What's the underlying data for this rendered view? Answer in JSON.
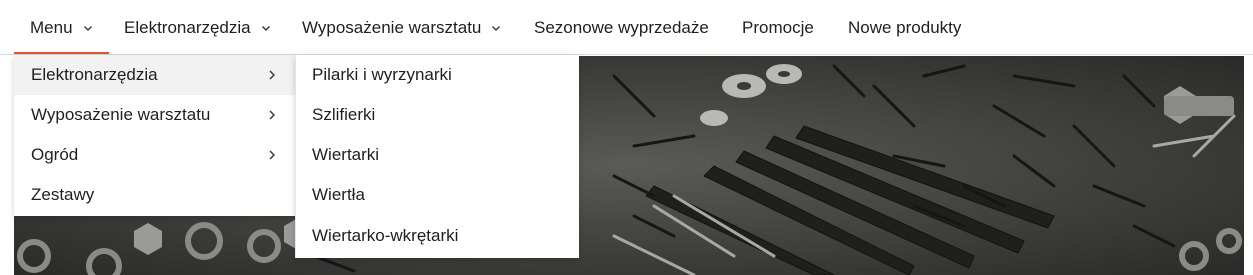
{
  "nav": {
    "items": [
      {
        "label": "Menu",
        "has_chevron": true
      },
      {
        "label": "Elektronarzędzia",
        "has_chevron": true
      },
      {
        "label": "Wyposażenie warsztatu",
        "has_chevron": true
      },
      {
        "label": "Sezonowe wyprzedaże",
        "has_chevron": false
      },
      {
        "label": "Promocje",
        "has_chevron": false
      },
      {
        "label": "Nowe produkty",
        "has_chevron": false
      }
    ],
    "active_index": 0,
    "accent_color": "#e2552b"
  },
  "dropdown": {
    "items": [
      {
        "label": "Elektronarzędzia",
        "has_arrow": true,
        "highlighted": true
      },
      {
        "label": "Wyposażenie warsztatu",
        "has_arrow": true,
        "highlighted": false
      },
      {
        "label": "Ogród",
        "has_arrow": true,
        "highlighted": false
      },
      {
        "label": "Zestawy",
        "has_arrow": false,
        "highlighted": false
      }
    ]
  },
  "submenu": {
    "items": [
      {
        "label": "Pilarki i wyrzynarki"
      },
      {
        "label": "Szlifierki"
      },
      {
        "label": "Wiertarki"
      },
      {
        "label": "Wiertła"
      },
      {
        "label": "Wiertarko-wkrętarki"
      }
    ]
  },
  "hero": {
    "icon": "hardware-photo"
  }
}
